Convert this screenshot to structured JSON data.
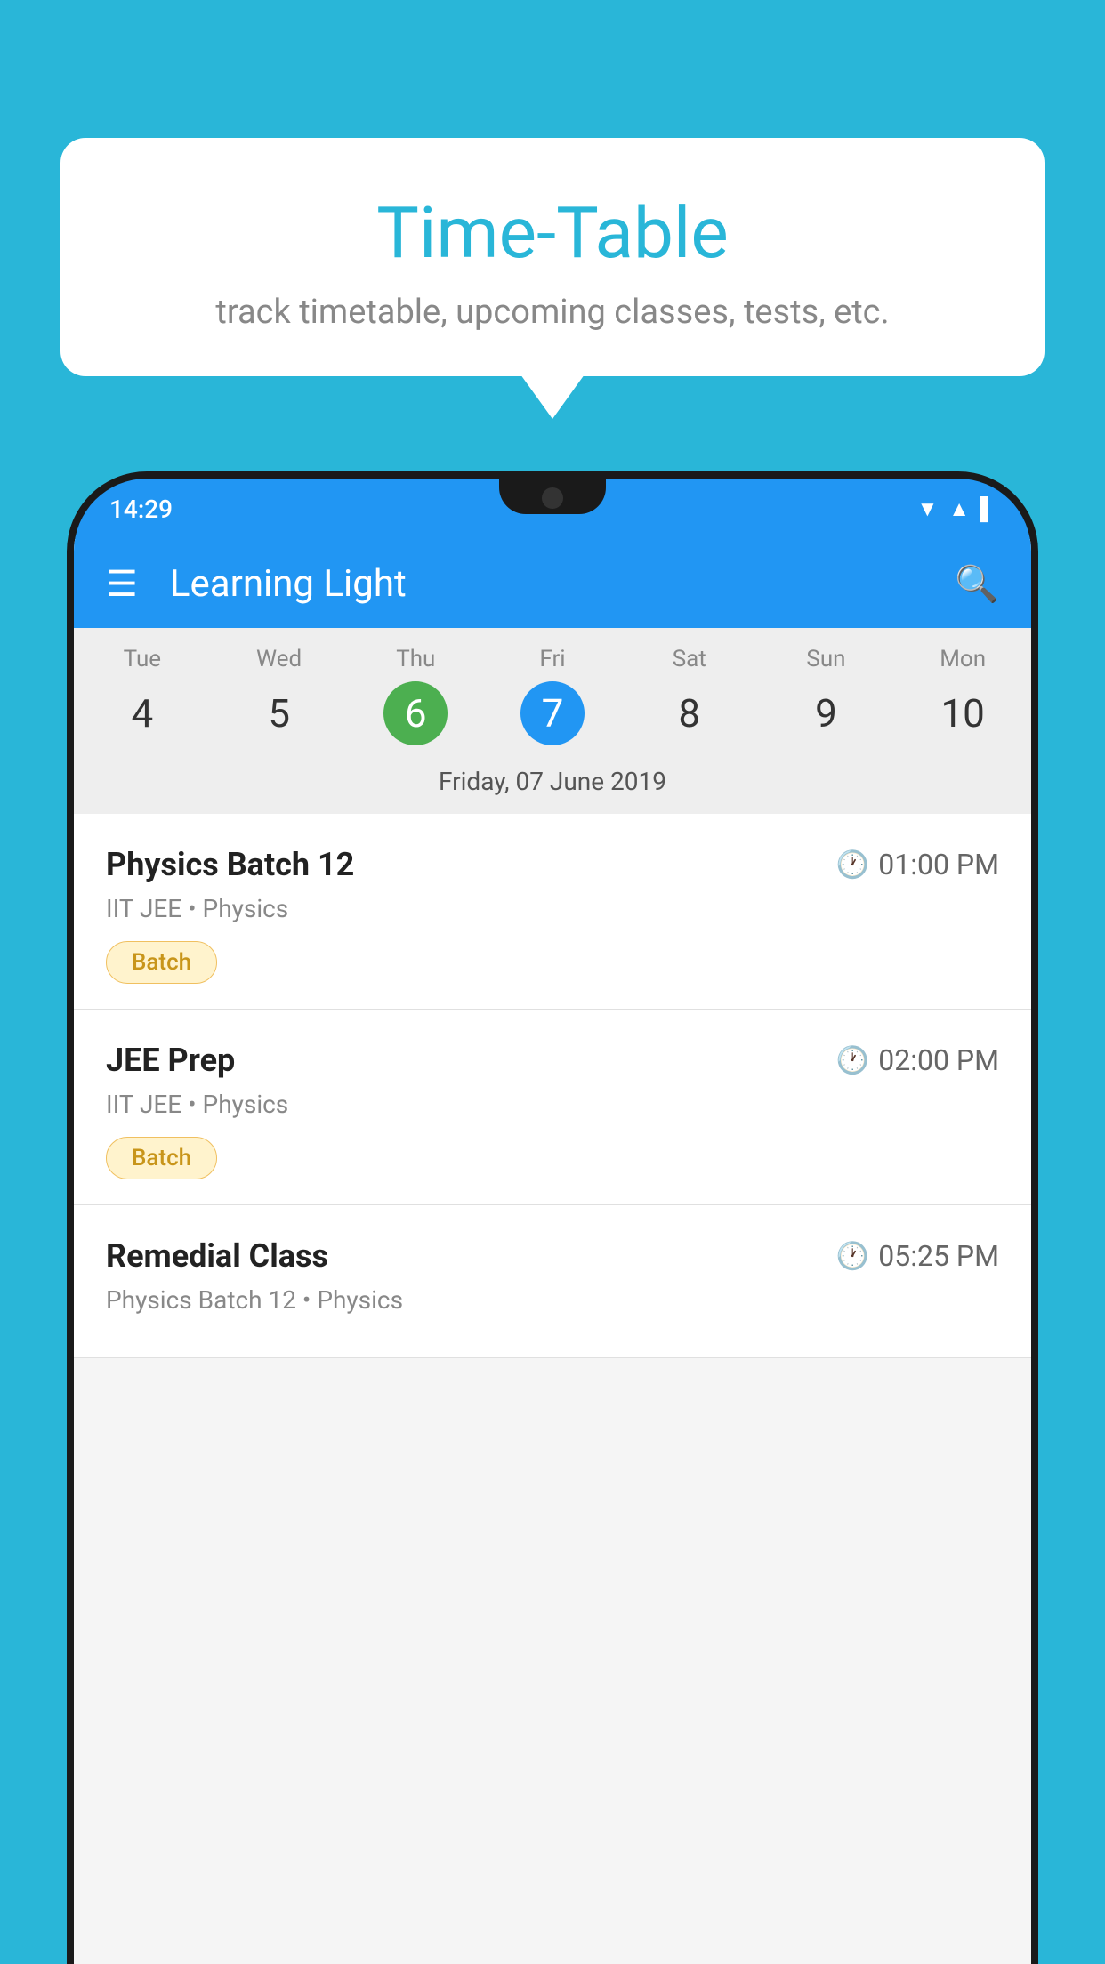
{
  "page": {
    "background_color": "#29B6D8"
  },
  "bubble": {
    "title": "Time-Table",
    "subtitle": "track timetable, upcoming classes, tests, etc."
  },
  "status_bar": {
    "time": "14:29"
  },
  "app_bar": {
    "title": "Learning Light"
  },
  "calendar": {
    "days": [
      {
        "name": "Tue",
        "number": "4",
        "state": "normal"
      },
      {
        "name": "Wed",
        "number": "5",
        "state": "normal"
      },
      {
        "name": "Thu",
        "number": "6",
        "state": "today"
      },
      {
        "name": "Fri",
        "number": "7",
        "state": "selected"
      },
      {
        "name": "Sat",
        "number": "8",
        "state": "normal"
      },
      {
        "name": "Sun",
        "number": "9",
        "state": "normal"
      },
      {
        "name": "Mon",
        "number": "10",
        "state": "normal"
      }
    ],
    "selected_date_label": "Friday, 07 June 2019"
  },
  "classes": [
    {
      "name": "Physics Batch 12",
      "time": "01:00 PM",
      "subject": "IIT JEE • Physics",
      "tag": "Batch"
    },
    {
      "name": "JEE Prep",
      "time": "02:00 PM",
      "subject": "IIT JEE • Physics",
      "tag": "Batch"
    },
    {
      "name": "Remedial Class",
      "time": "05:25 PM",
      "subject": "Physics Batch 12 • Physics",
      "tag": ""
    }
  ]
}
